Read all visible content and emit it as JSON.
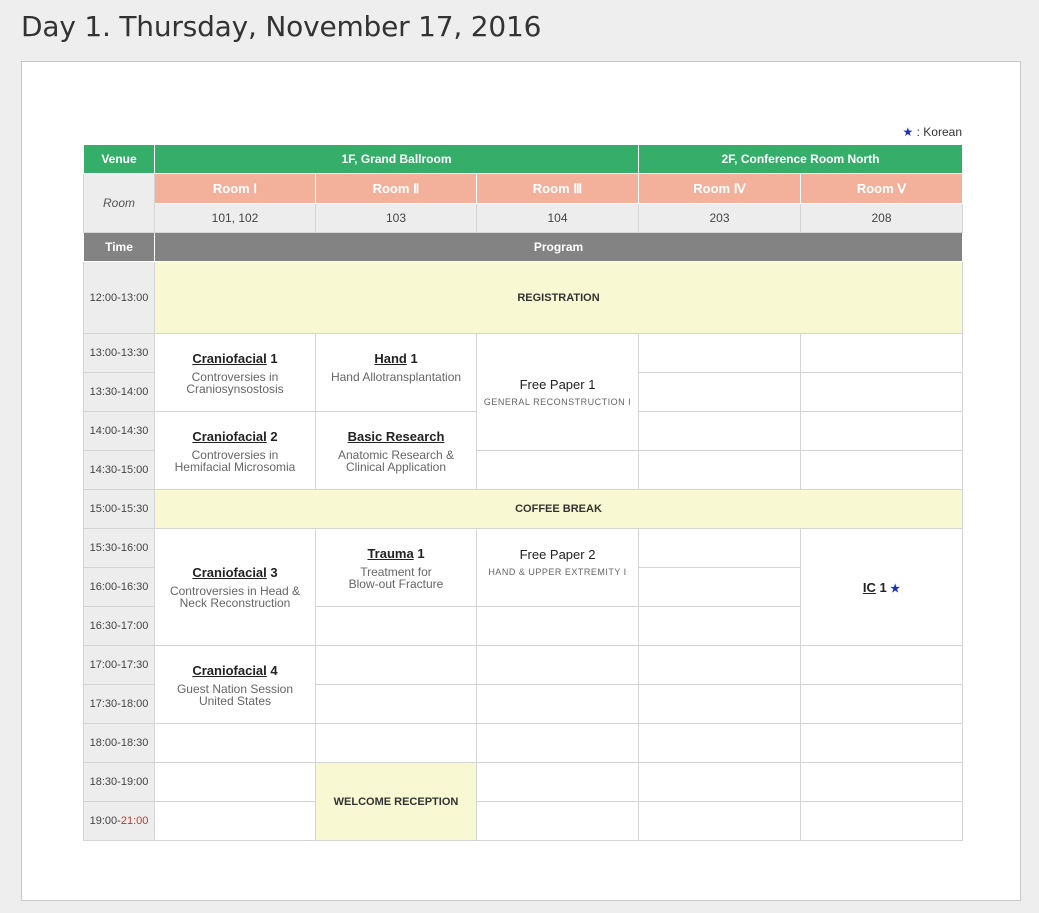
{
  "page": {
    "title": "Day 1. Thursday, November 17, 2016"
  },
  "legend": {
    "star": "★",
    "text": " : Korean"
  },
  "header": {
    "venue_label": "Venue",
    "venue_1f": "1F, Grand Ballroom",
    "venue_2f": "2F, Conference Room North",
    "room_label": "Room",
    "rooms": [
      {
        "name": "Room Ⅰ",
        "number": "101, 102"
      },
      {
        "name": "Room Ⅱ",
        "number": "103"
      },
      {
        "name": "Room Ⅲ",
        "number": "104"
      },
      {
        "name": "Room Ⅳ",
        "number": "203"
      },
      {
        "name": "Room Ⅴ",
        "number": "208"
      }
    ],
    "time_label": "Time",
    "program_label": "Program"
  },
  "times": {
    "t1200": "12:00-13:00",
    "t1300": "13:00-13:30",
    "t1330": "13:30-14:00",
    "t1400": "14:00-14:30",
    "t1430": "14:30-15:00",
    "t1500": "15:00-15:30",
    "t1530": "15:30-16:00",
    "t1600": "16:00-16:30",
    "t1630": "16:30-17:00",
    "t1700": "17:00-17:30",
    "t1730": "17:30-18:00",
    "t1800": "18:00-18:30",
    "t1830": "18:30-19:00",
    "t1900_start": "19:00-",
    "t1900_end": "21:00"
  },
  "program": {
    "registration": "REGISTRATION",
    "coffee_break": "COFFEE BREAK",
    "welcome_reception": "WELCOME RECEPTION",
    "cranio1": {
      "name": "Craniofacial",
      "num": " 1",
      "line1": "Controversies in",
      "line2": "Craniosynsostosis"
    },
    "hand1": {
      "name": "Hand",
      "num": " 1",
      "line1": "Hand Allotransplantation"
    },
    "free1": {
      "title": "Free Paper 1",
      "sub": "GENERAL RECONSTRUCTION I"
    },
    "cranio2": {
      "name": "Craniofacial",
      "num": " 2",
      "line1": "Controversies in",
      "line2": "Hemifacial Microsomia"
    },
    "basic": {
      "name": "Basic Research",
      "line1": "Anatomic Research &",
      "line2": "Clinical Application"
    },
    "cranio3": {
      "name": "Craniofacial",
      "num": " 3",
      "line1": "Controversies in Head &",
      "line2": "Neck Reconstruction"
    },
    "trauma1": {
      "name": "Trauma",
      "num": " 1",
      "line1": "Treatment for",
      "line2": "Blow-out Fracture"
    },
    "free2": {
      "title": "Free Paper 2",
      "sub": "HAND & UPPER EXTREMITY I"
    },
    "ic1": {
      "name": "IC",
      "num": " 1",
      "star": "★"
    },
    "cranio4": {
      "name": "Craniofacial",
      "num": " 4",
      "line1": "Guest Nation Session",
      "line2": "United States"
    }
  }
}
